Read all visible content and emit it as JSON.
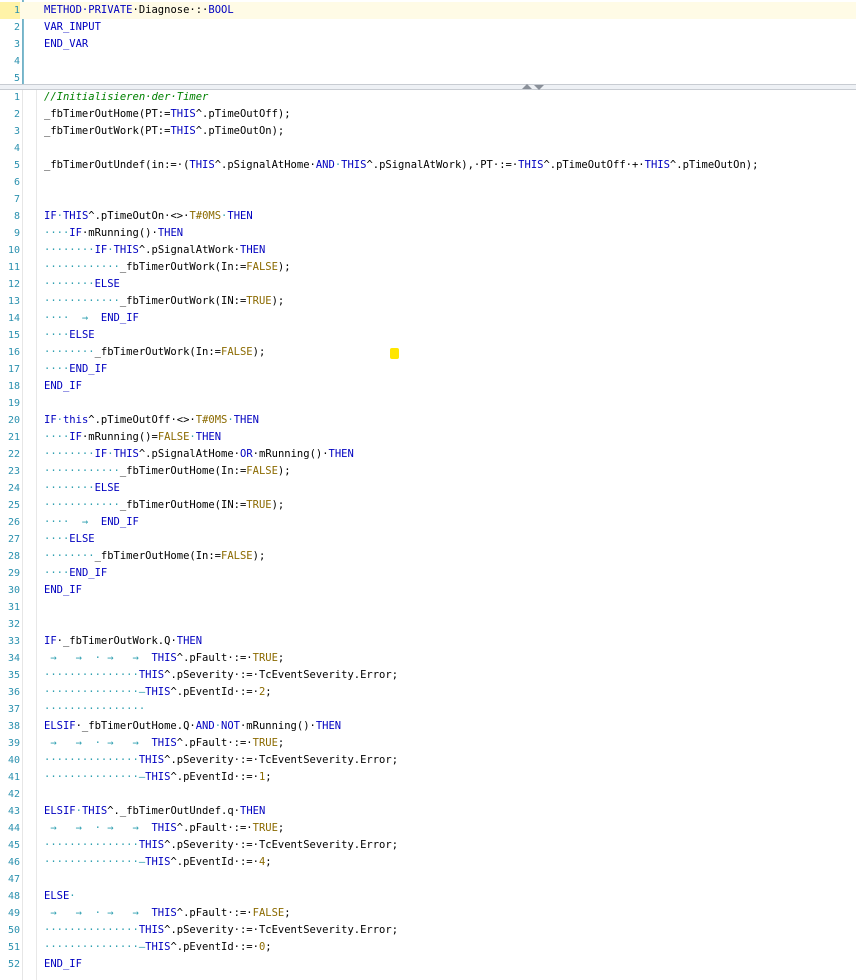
{
  "decl": {
    "lines": [
      {
        "n": "1",
        "tokens": [
          {
            "t": "METHOD·PRIVATE",
            "c": "kw"
          },
          {
            "t": "·Diagnose·:·",
            "c": "id"
          },
          {
            "t": "BOOL",
            "c": "kw"
          }
        ]
      },
      {
        "n": "2",
        "tokens": [
          {
            "t": "VAR_INPUT",
            "c": "kw"
          }
        ]
      },
      {
        "n": "3",
        "tokens": [
          {
            "t": "END_VAR",
            "c": "kw"
          }
        ]
      },
      {
        "n": "4",
        "tokens": []
      },
      {
        "n": "5",
        "tokens": []
      }
    ]
  },
  "impl": {
    "lines": [
      {
        "n": "1",
        "tokens": [
          {
            "t": "//Initialisieren·der·Timer",
            "c": "cm"
          }
        ]
      },
      {
        "n": "2",
        "tokens": [
          {
            "t": "_fbTimerOutHome(PT:=",
            "c": "id"
          },
          {
            "t": "THIS",
            "c": "kw"
          },
          {
            "t": "^.pTimeOutOff);",
            "c": "id"
          }
        ]
      },
      {
        "n": "3",
        "tokens": [
          {
            "t": "_fbTimerOutWork(PT:=",
            "c": "id"
          },
          {
            "t": "THIS",
            "c": "kw"
          },
          {
            "t": "^.pTimeOutOn);",
            "c": "id"
          }
        ]
      },
      {
        "n": "4",
        "tokens": []
      },
      {
        "n": "5",
        "tokens": [
          {
            "t": "_fbTimerOutUndef(in:=·(",
            "c": "id"
          },
          {
            "t": "THIS",
            "c": "kw"
          },
          {
            "t": "^.pSignalAtHome·",
            "c": "id"
          },
          {
            "t": "AND",
            "c": "kw"
          },
          {
            "t": "·",
            "c": "ws"
          },
          {
            "t": "THIS",
            "c": "kw"
          },
          {
            "t": "^.pSignalAtWork),·PT·:=·",
            "c": "id"
          },
          {
            "t": "THIS",
            "c": "kw"
          },
          {
            "t": "^.pTimeOutOff·+·",
            "c": "id"
          },
          {
            "t": "THIS",
            "c": "kw"
          },
          {
            "t": "^.pTimeOutOn);",
            "c": "id"
          }
        ]
      },
      {
        "n": "6",
        "tokens": []
      },
      {
        "n": "7",
        "tokens": []
      },
      {
        "n": "8",
        "tokens": [
          {
            "t": "IF",
            "c": "kw"
          },
          {
            "t": "·",
            "c": "ws"
          },
          {
            "t": "THIS",
            "c": "kw"
          },
          {
            "t": "^.pTimeOutOn·<>·",
            "c": "id"
          },
          {
            "t": "T#0MS",
            "c": "lit"
          },
          {
            "t": "·",
            "c": "ws"
          },
          {
            "t": "THEN",
            "c": "kw"
          }
        ]
      },
      {
        "n": "9",
        "tokens": [
          {
            "t": "····",
            "c": "ws"
          },
          {
            "t": "IF",
            "c": "kw"
          },
          {
            "t": "·mRunning()·",
            "c": "id"
          },
          {
            "t": "THEN",
            "c": "kw"
          }
        ]
      },
      {
        "n": "10",
        "tokens": [
          {
            "t": "········",
            "c": "ws"
          },
          {
            "t": "IF",
            "c": "kw"
          },
          {
            "t": "·",
            "c": "ws"
          },
          {
            "t": "THIS",
            "c": "kw"
          },
          {
            "t": "^.pSignalAtWork·",
            "c": "id"
          },
          {
            "t": "THEN",
            "c": "kw"
          }
        ]
      },
      {
        "n": "11",
        "tokens": [
          {
            "t": "············",
            "c": "ws"
          },
          {
            "t": "_fbTimerOutWork(In:=",
            "c": "id"
          },
          {
            "t": "FALSE",
            "c": "lit"
          },
          {
            "t": ");",
            "c": "id"
          }
        ]
      },
      {
        "n": "12",
        "tokens": [
          {
            "t": "········",
            "c": "ws"
          },
          {
            "t": "ELSE",
            "c": "kw"
          }
        ]
      },
      {
        "n": "13",
        "tokens": [
          {
            "t": "············",
            "c": "ws"
          },
          {
            "t": "_fbTimerOutWork(IN:=",
            "c": "id"
          },
          {
            "t": "TRUE",
            "c": "lit"
          },
          {
            "t": ");",
            "c": "id"
          }
        ]
      },
      {
        "n": "14",
        "tokens": [
          {
            "t": "····  →  ",
            "c": "ws"
          },
          {
            "t": "END_IF",
            "c": "kw"
          }
        ]
      },
      {
        "n": "15",
        "tokens": [
          {
            "t": "····",
            "c": "ws"
          },
          {
            "t": "ELSE",
            "c": "kw"
          }
        ]
      },
      {
        "n": "16",
        "tokens": [
          {
            "t": "········",
            "c": "ws"
          },
          {
            "t": "_fbTimerOutWork(In:=",
            "c": "id"
          },
          {
            "t": "FALSE",
            "c": "lit"
          },
          {
            "t": ");",
            "c": "id"
          }
        ]
      },
      {
        "n": "17",
        "tokens": [
          {
            "t": "····",
            "c": "ws"
          },
          {
            "t": "END_IF",
            "c": "kw"
          }
        ]
      },
      {
        "n": "18",
        "tokens": [
          {
            "t": "END_IF",
            "c": "kw"
          }
        ]
      },
      {
        "n": "19",
        "tokens": []
      },
      {
        "n": "20",
        "tokens": [
          {
            "t": "IF",
            "c": "kw"
          },
          {
            "t": "·",
            "c": "ws"
          },
          {
            "t": "this",
            "c": "kw"
          },
          {
            "t": "^.pTimeOutOff·<>·",
            "c": "id"
          },
          {
            "t": "T#0MS",
            "c": "lit"
          },
          {
            "t": "·",
            "c": "ws"
          },
          {
            "t": "THEN",
            "c": "kw"
          }
        ]
      },
      {
        "n": "21",
        "tokens": [
          {
            "t": "····",
            "c": "ws"
          },
          {
            "t": "IF",
            "c": "kw"
          },
          {
            "t": "·mRunning()=",
            "c": "id"
          },
          {
            "t": "FALSE",
            "c": "lit"
          },
          {
            "t": "·",
            "c": "ws"
          },
          {
            "t": "THEN",
            "c": "kw"
          }
        ]
      },
      {
        "n": "22",
        "tokens": [
          {
            "t": "········",
            "c": "ws"
          },
          {
            "t": "IF",
            "c": "kw"
          },
          {
            "t": "·",
            "c": "ws"
          },
          {
            "t": "THIS",
            "c": "kw"
          },
          {
            "t": "^.pSignalAtHome·",
            "c": "id"
          },
          {
            "t": "OR",
            "c": "kw"
          },
          {
            "t": "·mRunning()·",
            "c": "id"
          },
          {
            "t": "THEN",
            "c": "kw"
          }
        ]
      },
      {
        "n": "23",
        "tokens": [
          {
            "t": "············",
            "c": "ws"
          },
          {
            "t": "_fbTimerOutHome(In:=",
            "c": "id"
          },
          {
            "t": "FALSE",
            "c": "lit"
          },
          {
            "t": ");",
            "c": "id"
          }
        ]
      },
      {
        "n": "24",
        "tokens": [
          {
            "t": "········",
            "c": "ws"
          },
          {
            "t": "ELSE",
            "c": "kw"
          }
        ]
      },
      {
        "n": "25",
        "tokens": [
          {
            "t": "············",
            "c": "ws"
          },
          {
            "t": "_fbTimerOutHome(IN:=",
            "c": "id"
          },
          {
            "t": "TRUE",
            "c": "lit"
          },
          {
            "t": ");",
            "c": "id"
          }
        ]
      },
      {
        "n": "26",
        "tokens": [
          {
            "t": "····  →  ",
            "c": "ws"
          },
          {
            "t": "END_IF",
            "c": "kw"
          }
        ]
      },
      {
        "n": "27",
        "tokens": [
          {
            "t": "····",
            "c": "ws"
          },
          {
            "t": "ELSE",
            "c": "kw"
          }
        ]
      },
      {
        "n": "28",
        "tokens": [
          {
            "t": "········",
            "c": "ws"
          },
          {
            "t": "_fbTimerOutHome(In:=",
            "c": "id"
          },
          {
            "t": "FALSE",
            "c": "lit"
          },
          {
            "t": ");",
            "c": "id"
          }
        ]
      },
      {
        "n": "29",
        "tokens": [
          {
            "t": "····",
            "c": "ws"
          },
          {
            "t": "END_IF",
            "c": "kw"
          }
        ]
      },
      {
        "n": "30",
        "tokens": [
          {
            "t": "END_IF",
            "c": "kw"
          }
        ]
      },
      {
        "n": "31",
        "tokens": []
      },
      {
        "n": "32",
        "tokens": []
      },
      {
        "n": "33",
        "tokens": [
          {
            "t": "IF",
            "c": "kw"
          },
          {
            "t": "·_fbTimerOutWork.Q·",
            "c": "id"
          },
          {
            "t": "THEN",
            "c": "kw"
          }
        ]
      },
      {
        "n": "34",
        "tokens": [
          {
            "t": " →   →  · →   →  ",
            "c": "ws"
          },
          {
            "t": "THIS",
            "c": "kw"
          },
          {
            "t": "^.pFault·:=·",
            "c": "id"
          },
          {
            "t": "TRUE",
            "c": "lit"
          },
          {
            "t": ";",
            "c": "id"
          }
        ]
      },
      {
        "n": "35",
        "tokens": [
          {
            "t": "···············",
            "c": "ws"
          },
          {
            "t": "THIS",
            "c": "kw"
          },
          {
            "t": "^.pSeverity·:=·TcEventSeverity.Error;",
            "c": "id"
          }
        ]
      },
      {
        "n": "36",
        "tokens": [
          {
            "t": "···············—",
            "c": "ws"
          },
          {
            "t": "THIS",
            "c": "kw"
          },
          {
            "t": "^.pEventId·:=·",
            "c": "id"
          },
          {
            "t": "2",
            "c": "lit"
          },
          {
            "t": ";",
            "c": "id"
          }
        ]
      },
      {
        "n": "37",
        "tokens": [
          {
            "t": "················",
            "c": "ws"
          }
        ]
      },
      {
        "n": "38",
        "tokens": [
          {
            "t": "ELSIF",
            "c": "kw"
          },
          {
            "t": "·_fbTimerOutHome.Q·",
            "c": "id"
          },
          {
            "t": "AND",
            "c": "kw"
          },
          {
            "t": "·",
            "c": "ws"
          },
          {
            "t": "NOT",
            "c": "kw"
          },
          {
            "t": "·mRunning()·",
            "c": "id"
          },
          {
            "t": "THEN",
            "c": "kw"
          }
        ]
      },
      {
        "n": "39",
        "tokens": [
          {
            "t": " →   →  · →   →  ",
            "c": "ws"
          },
          {
            "t": "THIS",
            "c": "kw"
          },
          {
            "t": "^.pFault·:=·",
            "c": "id"
          },
          {
            "t": "TRUE",
            "c": "lit"
          },
          {
            "t": ";",
            "c": "id"
          }
        ]
      },
      {
        "n": "40",
        "tokens": [
          {
            "t": "···············",
            "c": "ws"
          },
          {
            "t": "THIS",
            "c": "kw"
          },
          {
            "t": "^.pSeverity·:=·TcEventSeverity.Error;",
            "c": "id"
          }
        ]
      },
      {
        "n": "41",
        "tokens": [
          {
            "t": "···············—",
            "c": "ws"
          },
          {
            "t": "THIS",
            "c": "kw"
          },
          {
            "t": "^.pEventId·:=·",
            "c": "id"
          },
          {
            "t": "1",
            "c": "lit"
          },
          {
            "t": ";",
            "c": "id"
          }
        ]
      },
      {
        "n": "42",
        "tokens": []
      },
      {
        "n": "43",
        "tokens": [
          {
            "t": "ELSIF",
            "c": "kw"
          },
          {
            "t": "·",
            "c": "ws"
          },
          {
            "t": "THIS",
            "c": "kw"
          },
          {
            "t": "^._fbTimerOutUndef.q·",
            "c": "id"
          },
          {
            "t": "THEN",
            "c": "kw"
          }
        ]
      },
      {
        "n": "44",
        "tokens": [
          {
            "t": " →   →  · →   →  ",
            "c": "ws"
          },
          {
            "t": "THIS",
            "c": "kw"
          },
          {
            "t": "^.pFault·:=·",
            "c": "id"
          },
          {
            "t": "TRUE",
            "c": "lit"
          },
          {
            "t": ";",
            "c": "id"
          }
        ]
      },
      {
        "n": "45",
        "tokens": [
          {
            "t": "···············",
            "c": "ws"
          },
          {
            "t": "THIS",
            "c": "kw"
          },
          {
            "t": "^.pSeverity·:=·TcEventSeverity.Error;",
            "c": "id"
          }
        ]
      },
      {
        "n": "46",
        "tokens": [
          {
            "t": "···············—",
            "c": "ws"
          },
          {
            "t": "THIS",
            "c": "kw"
          },
          {
            "t": "^.pEventId·:=·",
            "c": "id"
          },
          {
            "t": "4",
            "c": "lit"
          },
          {
            "t": ";",
            "c": "id"
          }
        ]
      },
      {
        "n": "47",
        "tokens": []
      },
      {
        "n": "48",
        "tokens": [
          {
            "t": "ELSE",
            "c": "kw"
          },
          {
            "t": "·",
            "c": "ws"
          }
        ]
      },
      {
        "n": "49",
        "tokens": [
          {
            "t": " →   →  · →   →  ",
            "c": "ws"
          },
          {
            "t": "THIS",
            "c": "kw"
          },
          {
            "t": "^.pFault·:=·",
            "c": "id"
          },
          {
            "t": "FALSE",
            "c": "lit"
          },
          {
            "t": ";",
            "c": "id"
          }
        ]
      },
      {
        "n": "50",
        "tokens": [
          {
            "t": "···············",
            "c": "ws"
          },
          {
            "t": "THIS",
            "c": "kw"
          },
          {
            "t": "^.pSeverity·:=·TcEventSeverity.Error;",
            "c": "id"
          }
        ]
      },
      {
        "n": "51",
        "tokens": [
          {
            "t": "···············—",
            "c": "ws"
          },
          {
            "t": "THIS",
            "c": "kw"
          },
          {
            "t": "^.pEventId·:=·",
            "c": "id"
          },
          {
            "t": "0",
            "c": "lit"
          },
          {
            "t": ";",
            "c": "id"
          }
        ]
      },
      {
        "n": "52",
        "tokens": [
          {
            "t": "END_IF",
            "c": "kw"
          }
        ]
      }
    ]
  }
}
